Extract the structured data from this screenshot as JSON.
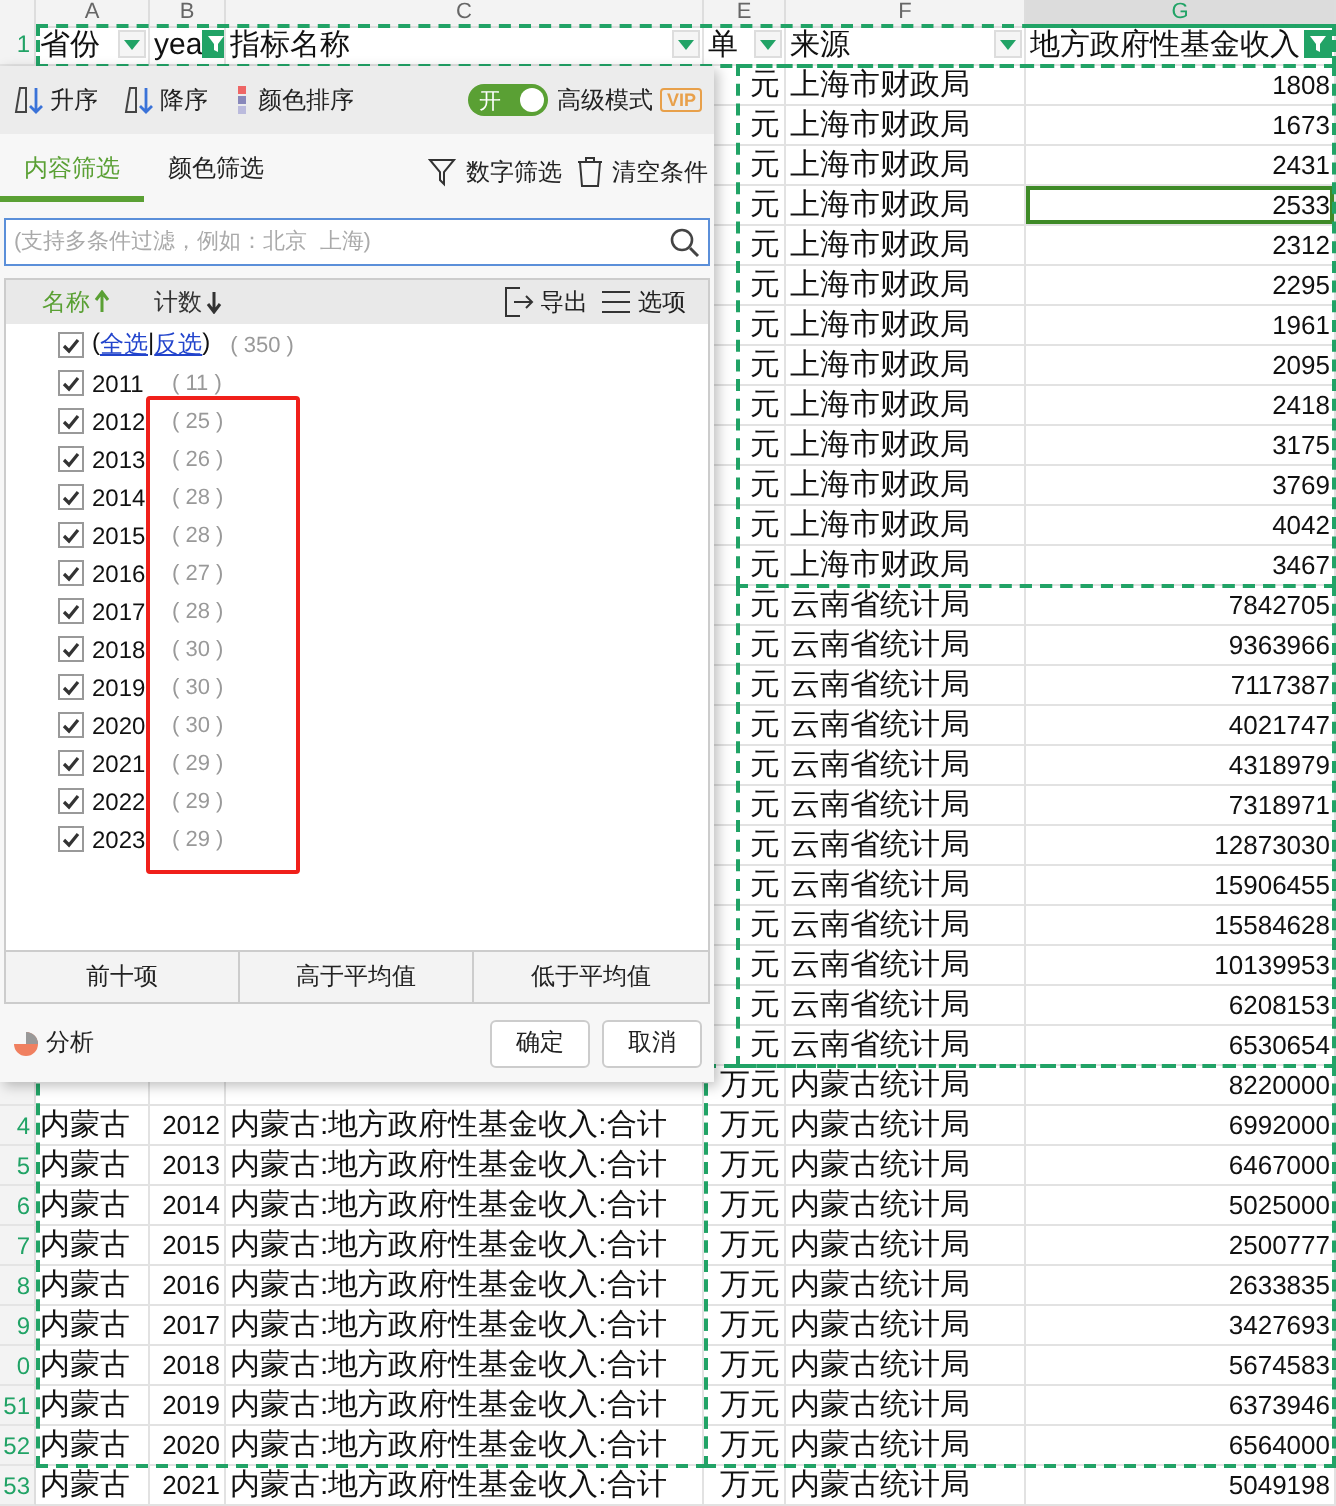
{
  "column_letters": [
    {
      "letter": "A",
      "selected": false
    },
    {
      "letter": "B",
      "selected": false
    },
    {
      "letter": "C",
      "selected": false
    },
    {
      "letter": "E",
      "selected": false
    },
    {
      "letter": "F",
      "selected": false
    },
    {
      "letter": "G",
      "selected": true
    }
  ],
  "header": {
    "row_number": "1",
    "cells": [
      {
        "text": "省份",
        "filtered": false
      },
      {
        "text": "yea",
        "filtered": true
      },
      {
        "text": "指标名称",
        "filtered": false
      },
      {
        "text": "单",
        "filtered": false
      },
      {
        "text": "来源",
        "filtered": false
      },
      {
        "text": "地方政府性基金收入",
        "filtered": true
      }
    ]
  },
  "rows": [
    {
      "unit": "元",
      "source": "上海市财政局",
      "value": "1808",
      "selected": false
    },
    {
      "unit": "元",
      "source": "上海市财政局",
      "value": "1673",
      "selected": false
    },
    {
      "unit": "元",
      "source": "上海市财政局",
      "value": "2431",
      "selected": false
    },
    {
      "unit": "元",
      "source": "上海市财政局",
      "value": "2533",
      "selected": true
    },
    {
      "unit": "元",
      "source": "上海市财政局",
      "value": "2312",
      "selected": false
    },
    {
      "unit": "元",
      "source": "上海市财政局",
      "value": "2295",
      "selected": false
    },
    {
      "unit": "元",
      "source": "上海市财政局",
      "value": "1961",
      "selected": false
    },
    {
      "unit": "元",
      "source": "上海市财政局",
      "value": "2095",
      "selected": false
    },
    {
      "unit": "元",
      "source": "上海市财政局",
      "value": "2418",
      "selected": false
    },
    {
      "unit": "元",
      "source": "上海市财政局",
      "value": "3175",
      "selected": false
    },
    {
      "unit": "元",
      "source": "上海市财政局",
      "value": "3769",
      "selected": false
    },
    {
      "unit": "元",
      "source": "上海市财政局",
      "value": "4042",
      "selected": false
    },
    {
      "unit": "元",
      "source": "上海市财政局",
      "value": "3467",
      "selected": false
    },
    {
      "unit": "元",
      "source": "云南省统计局",
      "value": "7842705",
      "selected": false
    },
    {
      "unit": "元",
      "source": "云南省统计局",
      "value": "9363966",
      "selected": false
    },
    {
      "unit": "元",
      "source": "云南省统计局",
      "value": "7117387",
      "selected": false
    },
    {
      "unit": "元",
      "source": "云南省统计局",
      "value": "4021747",
      "selected": false
    },
    {
      "unit": "元",
      "source": "云南省统计局",
      "value": "4318979",
      "selected": false
    },
    {
      "unit": "元",
      "source": "云南省统计局",
      "value": "7318971",
      "selected": false
    },
    {
      "unit": "元",
      "source": "云南省统计局",
      "value": "12873030",
      "selected": false
    },
    {
      "unit": "元",
      "source": "云南省统计局",
      "value": "15906455",
      "selected": false
    },
    {
      "unit": "元",
      "source": "云南省统计局",
      "value": "15584628",
      "selected": false
    },
    {
      "unit": "元",
      "source": "云南省统计局",
      "value": "10139953",
      "selected": false
    },
    {
      "unit": "元",
      "source": "云南省统计局",
      "value": "6208153",
      "selected": false
    },
    {
      "unit": "元",
      "source": "云南省统计局",
      "value": "6530654",
      "selected": false
    },
    {
      "unit": "万元",
      "source": "内蒙古统计局",
      "value": "8220000",
      "selected": false
    },
    {
      "row_number": "4",
      "province": "内蒙古",
      "year": "2012",
      "indicator": "内蒙古:地方政府性基金收入:合计",
      "unit": "万元",
      "source": "内蒙古统计局",
      "value": "6992000",
      "selected": false
    },
    {
      "row_number": "5",
      "province": "内蒙古",
      "year": "2013",
      "indicator": "内蒙古:地方政府性基金收入:合计",
      "unit": "万元",
      "source": "内蒙古统计局",
      "value": "6467000",
      "selected": false
    },
    {
      "row_number": "6",
      "province": "内蒙古",
      "year": "2014",
      "indicator": "内蒙古:地方政府性基金收入:合计",
      "unit": "万元",
      "source": "内蒙古统计局",
      "value": "5025000",
      "selected": false
    },
    {
      "row_number": "7",
      "province": "内蒙古",
      "year": "2015",
      "indicator": "内蒙古:地方政府性基金收入:合计",
      "unit": "万元",
      "source": "内蒙古统计局",
      "value": "2500777",
      "selected": false
    },
    {
      "row_number": "8",
      "province": "内蒙古",
      "year": "2016",
      "indicator": "内蒙古:地方政府性基金收入:合计",
      "unit": "万元",
      "source": "内蒙古统计局",
      "value": "2633835",
      "selected": false
    },
    {
      "row_number": "9",
      "province": "内蒙古",
      "year": "2017",
      "indicator": "内蒙古:地方政府性基金收入:合计",
      "unit": "万元",
      "source": "内蒙古统计局",
      "value": "3427693",
      "selected": false
    },
    {
      "row_number": "0",
      "province": "内蒙古",
      "year": "2018",
      "indicator": "内蒙古:地方政府性基金收入:合计",
      "unit": "万元",
      "source": "内蒙古统计局",
      "value": "5674583",
      "selected": false
    },
    {
      "row_number": "51",
      "province": "内蒙古",
      "year": "2019",
      "indicator": "内蒙古:地方政府性基金收入:合计",
      "unit": "万元",
      "source": "内蒙古统计局",
      "value": "6373946",
      "selected": false
    },
    {
      "row_number": "52",
      "province": "内蒙古",
      "year": "2020",
      "indicator": "内蒙古:地方政府性基金收入:合计",
      "unit": "万元",
      "source": "内蒙古统计局",
      "value": "6564000",
      "selected": false
    },
    {
      "row_number": "53",
      "province": "内蒙古",
      "year": "2021",
      "indicator": "内蒙古:地方政府性基金收入:合计",
      "unit": "万元",
      "source": "内蒙古统计局",
      "value": "5049198",
      "selected": false
    }
  ],
  "filter_panel": {
    "sort_buttons": [
      {
        "label": "升序",
        "kind": "ascending"
      },
      {
        "label": "降序",
        "kind": "descending"
      },
      {
        "label": "颜色排序",
        "kind": "color"
      }
    ],
    "advanced_toggle": {
      "on": true,
      "label": "开"
    },
    "advanced_label": "高级模式",
    "vip_badge": "VIP",
    "tabs": [
      {
        "label": "内容筛选",
        "selected": true
      },
      {
        "label": "颜色筛选",
        "selected": false
      }
    ],
    "actions": [
      {
        "label": "数字筛选",
        "kind": "funnel"
      },
      {
        "label": "清空条件",
        "kind": "trash"
      }
    ],
    "search": {
      "placeholder": "(支持多条件过滤，例如：北京  上海)"
    },
    "list_sorts": [
      {
        "label": "名称",
        "kind": "ascending",
        "selected": true
      },
      {
        "label": "计数",
        "kind": "descending",
        "selected": false
      }
    ],
    "list_actions": [
      {
        "label": "导出",
        "kind": "export"
      },
      {
        "label": "选项",
        "kind": "options"
      }
    ],
    "select_all": {
      "checked": true,
      "open": "(",
      "links": [
        "全选",
        "反选"
      ],
      "separator": "|",
      "close": ")",
      "count": "( 350 )"
    },
    "items": [
      {
        "label": "2011",
        "count": "( 11 )",
        "checked": true
      },
      {
        "label": "2012",
        "count": "( 25 )",
        "checked": true
      },
      {
        "label": "2013",
        "count": "( 26 )",
        "checked": true
      },
      {
        "label": "2014",
        "count": "( 28 )",
        "checked": true
      },
      {
        "label": "2015",
        "count": "( 28 )",
        "checked": true
      },
      {
        "label": "2016",
        "count": "( 27 )",
        "checked": true
      },
      {
        "label": "2017",
        "count": "( 28 )",
        "checked": true
      },
      {
        "label": "2018",
        "count": "( 30 )",
        "checked": true
      },
      {
        "label": "2019",
        "count": "( 30 )",
        "checked": true
      },
      {
        "label": "2020",
        "count": "( 30 )",
        "checked": true
      },
      {
        "label": "2021",
        "count": "( 29 )",
        "checked": true
      },
      {
        "label": "2022",
        "count": "( 29 )",
        "checked": true
      },
      {
        "label": "2023",
        "count": "( 29 )",
        "checked": true
      }
    ],
    "quick_filters": [
      "前十项",
      "高于平均值",
      "低于平均值"
    ],
    "analysis": "分析",
    "buttons": [
      "确定",
      "取消"
    ]
  }
}
